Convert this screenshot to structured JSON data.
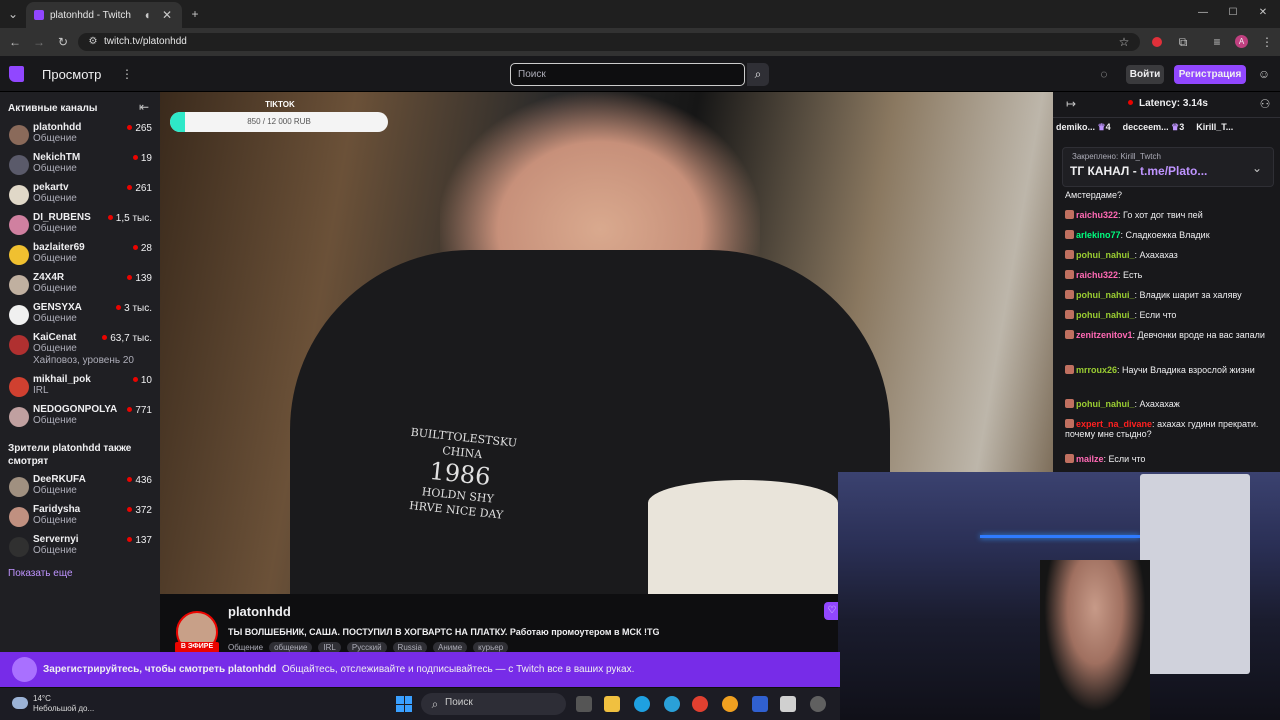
{
  "browser": {
    "tab_title": "platonhdd - Twitch",
    "url": "twitch.tv/platonhdd",
    "profile_initial": "A"
  },
  "topnav": {
    "browse_label": "Просмотр",
    "search_placeholder": "Поиск",
    "login_label": "Войти",
    "register_label": "Регистрация"
  },
  "sidebar": {
    "active_header": "Активные каналы",
    "channels": [
      {
        "name": "platonhdd",
        "category": "Общение",
        "viewers": "265",
        "color": "#8a6a5a"
      },
      {
        "name": "NekichTM",
        "category": "Общение",
        "viewers": "19",
        "color": "#5a5a6a"
      },
      {
        "name": "pekartv",
        "category": "Общение",
        "viewers": "261",
        "color": "#e0d8c8"
      },
      {
        "name": "DI_RUBENS",
        "category": "Общение",
        "viewers": "1,5 тыс.",
        "color": "#d080a0"
      },
      {
        "name": "bazlaiter69",
        "category": "Общение",
        "viewers": "28",
        "color": "#f0c030"
      },
      {
        "name": "Z4X4R",
        "category": "Общение",
        "viewers": "139",
        "color": "#c0b0a0"
      },
      {
        "name": "GENSYXA",
        "category": "Общение",
        "viewers": "3 тыс.",
        "color": "#f0f0f0"
      },
      {
        "name": "KaiCenat",
        "category": "Общение",
        "viewers": "63,7 тыс.",
        "color": "#b03030",
        "extra": "Хайповоз, уровень 20"
      },
      {
        "name": "mikhail_pok",
        "category": "IRL",
        "viewers": "10",
        "color": "#d04030"
      },
      {
        "name": "NEDOGONPOLYA",
        "category": "Общение",
        "viewers": "771",
        "color": "#c0a0a0"
      }
    ],
    "also_watch_header": "Зрители platonhdd также смотрят",
    "also_watch": [
      {
        "name": "DeeRKUFA",
        "category": "Общение",
        "viewers": "436",
        "color": "#a09080"
      },
      {
        "name": "Faridysha",
        "category": "Общение",
        "viewers": "372",
        "color": "#c09080"
      },
      {
        "name": "Servernyi",
        "category": "Общение",
        "viewers": "137",
        "color": "#303030"
      }
    ],
    "show_more": "Показать еще"
  },
  "video": {
    "tiktok_label": "TIKTOK",
    "goal_text": "850 / 12 000 RUB",
    "goal_progress": 0.07,
    "jacket_line1": "BUILTTOLESTSKU",
    "jacket_line2": "CHINA",
    "jacket_line3": "1986",
    "jacket_line4": "HOLDN SHY",
    "jacket_line5": "HRVE NICE DAY"
  },
  "stream_info": {
    "channel": "platonhdd",
    "title": "ТЫ ВОЛШЕБНИК, САША. ПОСТУПИЛ В ХОГВАРТС НА ПЛАТКУ. Работаю промоутером в МСК !TG",
    "live_badge": "В ЭФИРЕ",
    "category": "Общение",
    "tags": [
      "общение",
      "IRL",
      "Русский",
      "Russia",
      "Аниме",
      "курьер"
    ]
  },
  "chat": {
    "latency": "Latency: 3.14s",
    "gifters": [
      {
        "name": "demiko...",
        "count": "4"
      },
      {
        "name": "decceem...",
        "count": "3"
      },
      {
        "name": "Kirill_T...",
        "count": ""
      }
    ],
    "pinned_label": "Закреплено: Kirill_Twtch",
    "pinned_text": "ТГ КАНАЛ - ",
    "pinned_link": "t.me/Plato...",
    "messages": [
      {
        "user": "",
        "text": "Амстердаме?",
        "color": "#efeff1"
      },
      {
        "user": "raichu322",
        "text": "Го хот дог твич пей",
        "color": "#ff69b4"
      },
      {
        "user": "arlekino77",
        "text": "Сладкоежка Владик",
        "color": "#00ff7f"
      },
      {
        "user": "pohui_nahui_",
        "text": "Ахахахаз",
        "color": "#9acd32"
      },
      {
        "user": "raichu322",
        "text": "Есть",
        "color": "#ff69b4"
      },
      {
        "user": "pohui_nahui_",
        "text": "Владик шарит за халяву",
        "color": "#9acd32"
      },
      {
        "user": "pohui_nahui_",
        "text": "Если что",
        "color": "#9acd32"
      },
      {
        "user": "zenitzenitov1",
        "text": "Девчонки вроде на вас запали",
        "color": "#ff69b4"
      },
      {
        "user": "mrroux26",
        "text": "Научи Владика взрослой жизни",
        "color": "#9acd32"
      },
      {
        "user": "pohui_nahui_",
        "text": "Ахахахаж",
        "color": "#9acd32"
      },
      {
        "user": "expert_na_divane",
        "text": "ахахах гудини прекрати. почему мне стыдно?",
        "color": "#ff2020"
      },
      {
        "user": "mailze",
        "text": "Если что",
        "color": "#ff69b4"
      }
    ]
  },
  "banner": {
    "bold": "Зарегистрируйтесь, чтобы смотреть platonhdd",
    "text": "Общайтесь, отслеживайте и подписывайтесь — с Twitch все в ваших руках."
  },
  "taskbar": {
    "temp": "14°C",
    "weather": "Небольшой до...",
    "search": "Поиск"
  },
  "colors": {
    "accent": "#9147ff",
    "live": "#eb0400"
  }
}
